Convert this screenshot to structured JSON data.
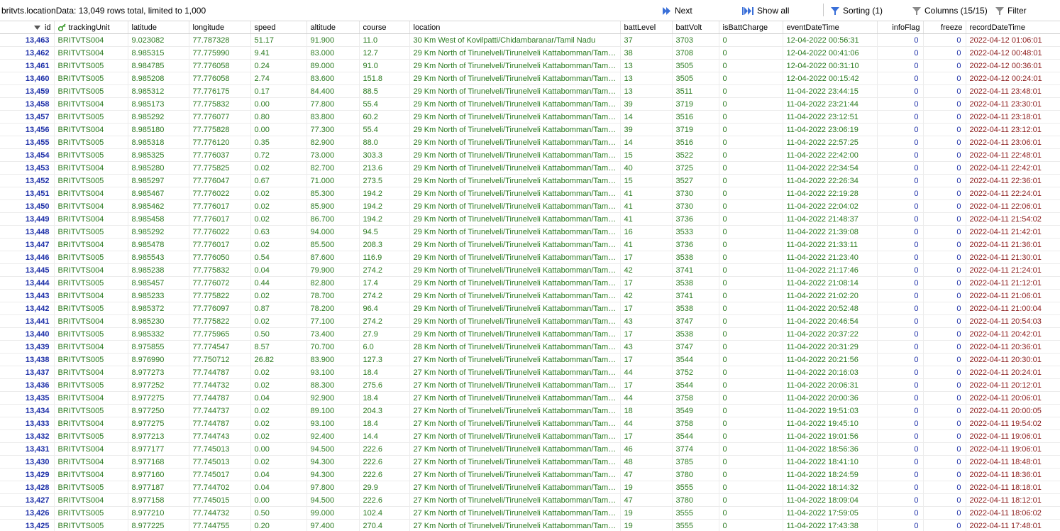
{
  "toolbar": {
    "title": "britvts.locationData: 13,049 rows total, limited to 1,000",
    "next": "Next",
    "show_all": "Show all",
    "sorting": "Sorting (1)",
    "columns": "Columns (15/15)",
    "filter": "Filter"
  },
  "columns": [
    "id",
    "trackingUnit",
    "latitude",
    "longitude",
    "speed",
    "altitude",
    "course",
    "location",
    "battLevel",
    "battVolt",
    "isBattCharge",
    "eventDateTime",
    "infoFlag",
    "freeze",
    "recordDateTime"
  ],
  "rows": [
    [
      "13,463",
      "BRITVTS004",
      "9.023082",
      "77.787328",
      "51.17",
      "91.900",
      "11.0",
      "30 Km West of Kovilpatti/Chidambaranar/Tamil Nadu",
      "37",
      "3703",
      "0",
      "12-04-2022 00:56:31",
      "0",
      "0",
      "2022-04-12 01:06:01"
    ],
    [
      "13,462",
      "BRITVTS004",
      "8.985315",
      "77.775990",
      "9.41",
      "83.000",
      "12.7",
      "29 Km North of Tirunelveli/Tirunelveli Kattabomman/Tamil...",
      "38",
      "3708",
      "0",
      "12-04-2022 00:41:06",
      "0",
      "0",
      "2022-04-12 00:48:01"
    ],
    [
      "13,461",
      "BRITVTS005",
      "8.984785",
      "77.776058",
      "0.24",
      "89.000",
      "91.0",
      "29 Km North of Tirunelveli/Tirunelveli Kattabomman/Tamil...",
      "13",
      "3505",
      "0",
      "12-04-2022 00:31:10",
      "0",
      "0",
      "2022-04-12 00:36:01"
    ],
    [
      "13,460",
      "BRITVTS005",
      "8.985208",
      "77.776058",
      "2.74",
      "83.600",
      "151.8",
      "29 Km North of Tirunelveli/Tirunelveli Kattabomman/Tamil...",
      "13",
      "3505",
      "0",
      "12-04-2022 00:15:42",
      "0",
      "0",
      "2022-04-12 00:24:01"
    ],
    [
      "13,459",
      "BRITVTS005",
      "8.985312",
      "77.776175",
      "0.17",
      "84.400",
      "88.5",
      "29 Km North of Tirunelveli/Tirunelveli Kattabomman/Tamil...",
      "13",
      "3511",
      "0",
      "11-04-2022 23:44:15",
      "0",
      "0",
      "2022-04-11 23:48:01"
    ],
    [
      "13,458",
      "BRITVTS004",
      "8.985173",
      "77.775832",
      "0.00",
      "77.800",
      "55.4",
      "29 Km North of Tirunelveli/Tirunelveli Kattabomman/Tamil...",
      "39",
      "3719",
      "0",
      "11-04-2022 23:21:44",
      "0",
      "0",
      "2022-04-11 23:30:01"
    ],
    [
      "13,457",
      "BRITVTS005",
      "8.985292",
      "77.776077",
      "0.80",
      "83.800",
      "60.2",
      "29 Km North of Tirunelveli/Tirunelveli Kattabomman/Tamil...",
      "14",
      "3516",
      "0",
      "11-04-2022 23:12:51",
      "0",
      "0",
      "2022-04-11 23:18:01"
    ],
    [
      "13,456",
      "BRITVTS004",
      "8.985180",
      "77.775828",
      "0.00",
      "77.300",
      "55.4",
      "29 Km North of Tirunelveli/Tirunelveli Kattabomman/Tamil...",
      "39",
      "3719",
      "0",
      "11-04-2022 23:06:19",
      "0",
      "0",
      "2022-04-11 23:12:01"
    ],
    [
      "13,455",
      "BRITVTS005",
      "8.985318",
      "77.776120",
      "0.35",
      "82.900",
      "88.0",
      "29 Km North of Tirunelveli/Tirunelveli Kattabomman/Tamil...",
      "14",
      "3516",
      "0",
      "11-04-2022 22:57:25",
      "0",
      "0",
      "2022-04-11 23:06:01"
    ],
    [
      "13,454",
      "BRITVTS005",
      "8.985325",
      "77.776037",
      "0.72",
      "73.000",
      "303.3",
      "29 Km North of Tirunelveli/Tirunelveli Kattabomman/Tamil...",
      "15",
      "3522",
      "0",
      "11-04-2022 22:42:00",
      "0",
      "0",
      "2022-04-11 22:48:01"
    ],
    [
      "13,453",
      "BRITVTS004",
      "8.985280",
      "77.775825",
      "0.02",
      "82.700",
      "213.6",
      "29 Km North of Tirunelveli/Tirunelveli Kattabomman/Tamil...",
      "40",
      "3725",
      "0",
      "11-04-2022 22:34:54",
      "0",
      "0",
      "2022-04-11 22:42:01"
    ],
    [
      "13,452",
      "BRITVTS005",
      "8.985297",
      "77.776047",
      "0.67",
      "71.000",
      "273.5",
      "29 Km North of Tirunelveli/Tirunelveli Kattabomman/Tamil...",
      "15",
      "3527",
      "0",
      "11-04-2022 22:26:34",
      "0",
      "0",
      "2022-04-11 22:36:01"
    ],
    [
      "13,451",
      "BRITVTS004",
      "8.985467",
      "77.776022",
      "0.02",
      "85.300",
      "194.2",
      "29 Km North of Tirunelveli/Tirunelveli Kattabomman/Tamil...",
      "41",
      "3730",
      "0",
      "11-04-2022 22:19:28",
      "0",
      "0",
      "2022-04-11 22:24:01"
    ],
    [
      "13,450",
      "BRITVTS004",
      "8.985462",
      "77.776017",
      "0.02",
      "85.900",
      "194.2",
      "29 Km North of Tirunelveli/Tirunelveli Kattabomman/Tamil...",
      "41",
      "3730",
      "0",
      "11-04-2022 22:04:02",
      "0",
      "0",
      "2022-04-11 22:06:01"
    ],
    [
      "13,449",
      "BRITVTS004",
      "8.985458",
      "77.776017",
      "0.02",
      "86.700",
      "194.2",
      "29 Km North of Tirunelveli/Tirunelveli Kattabomman/Tamil...",
      "41",
      "3736",
      "0",
      "11-04-2022 21:48:37",
      "0",
      "0",
      "2022-04-11 21:54:02"
    ],
    [
      "13,448",
      "BRITVTS005",
      "8.985292",
      "77.776022",
      "0.63",
      "94.000",
      "94.5",
      "29 Km North of Tirunelveli/Tirunelveli Kattabomman/Tamil...",
      "16",
      "3533",
      "0",
      "11-04-2022 21:39:08",
      "0",
      "0",
      "2022-04-11 21:42:01"
    ],
    [
      "13,447",
      "BRITVTS004",
      "8.985478",
      "77.776017",
      "0.02",
      "85.500",
      "208.3",
      "29 Km North of Tirunelveli/Tirunelveli Kattabomman/Tamil...",
      "41",
      "3736",
      "0",
      "11-04-2022 21:33:11",
      "0",
      "0",
      "2022-04-11 21:36:01"
    ],
    [
      "13,446",
      "BRITVTS005",
      "8.985543",
      "77.776050",
      "0.54",
      "87.600",
      "116.9",
      "29 Km North of Tirunelveli/Tirunelveli Kattabomman/Tamil...",
      "17",
      "3538",
      "0",
      "11-04-2022 21:23:40",
      "0",
      "0",
      "2022-04-11 21:30:01"
    ],
    [
      "13,445",
      "BRITVTS004",
      "8.985238",
      "77.775832",
      "0.04",
      "79.900",
      "274.2",
      "29 Km North of Tirunelveli/Tirunelveli Kattabomman/Tamil...",
      "42",
      "3741",
      "0",
      "11-04-2022 21:17:46",
      "0",
      "0",
      "2022-04-11 21:24:01"
    ],
    [
      "13,444",
      "BRITVTS005",
      "8.985457",
      "77.776072",
      "0.44",
      "82.800",
      "17.4",
      "29 Km North of Tirunelveli/Tirunelveli Kattabomman/Tamil...",
      "17",
      "3538",
      "0",
      "11-04-2022 21:08:14",
      "0",
      "0",
      "2022-04-11 21:12:01"
    ],
    [
      "13,443",
      "BRITVTS004",
      "8.985233",
      "77.775822",
      "0.02",
      "78.700",
      "274.2",
      "29 Km North of Tirunelveli/Tirunelveli Kattabomman/Tamil...",
      "42",
      "3741",
      "0",
      "11-04-2022 21:02:20",
      "0",
      "0",
      "2022-04-11 21:06:01"
    ],
    [
      "13,442",
      "BRITVTS005",
      "8.985372",
      "77.776097",
      "0.87",
      "78.200",
      "96.4",
      "29 Km North of Tirunelveli/Tirunelveli Kattabomman/Tamil...",
      "17",
      "3538",
      "0",
      "11-04-2022 20:52:48",
      "0",
      "0",
      "2022-04-11 21:00:04"
    ],
    [
      "13,441",
      "BRITVTS004",
      "8.985230",
      "77.775822",
      "0.02",
      "77.100",
      "274.2",
      "29 Km North of Tirunelveli/Tirunelveli Kattabomman/Tamil...",
      "43",
      "3747",
      "0",
      "11-04-2022 20:46:54",
      "0",
      "0",
      "2022-04-11 20:54:03"
    ],
    [
      "13,440",
      "BRITVTS005",
      "8.985332",
      "77.775965",
      "0.50",
      "73.400",
      "27.9",
      "29 Km North of Tirunelveli/Tirunelveli Kattabomman/Tamil...",
      "17",
      "3538",
      "0",
      "11-04-2022 20:37:22",
      "0",
      "0",
      "2022-04-11 20:42:01"
    ],
    [
      "13,439",
      "BRITVTS004",
      "8.975855",
      "77.774547",
      "8.57",
      "70.700",
      "6.0",
      "28 Km North of Tirunelveli/Tirunelveli Kattabomman/Tamil...",
      "43",
      "3747",
      "0",
      "11-04-2022 20:31:29",
      "0",
      "0",
      "2022-04-11 20:36:01"
    ],
    [
      "13,438",
      "BRITVTS005",
      "8.976990",
      "77.750712",
      "26.82",
      "83.900",
      "127.3",
      "27 Km North of Tirunelveli/Tirunelveli Kattabomman/Tamil...",
      "17",
      "3544",
      "0",
      "11-04-2022 20:21:56",
      "0",
      "0",
      "2022-04-11 20:30:01"
    ],
    [
      "13,437",
      "BRITVTS004",
      "8.977273",
      "77.744787",
      "0.02",
      "93.100",
      "18.4",
      "27 Km North of Tirunelveli/Tirunelveli Kattabomman/Tamil...",
      "44",
      "3752",
      "0",
      "11-04-2022 20:16:03",
      "0",
      "0",
      "2022-04-11 20:24:01"
    ],
    [
      "13,436",
      "BRITVTS005",
      "8.977252",
      "77.744732",
      "0.02",
      "88.300",
      "275.6",
      "27 Km North of Tirunelveli/Tirunelveli Kattabomman/Tamil...",
      "17",
      "3544",
      "0",
      "11-04-2022 20:06:31",
      "0",
      "0",
      "2022-04-11 20:12:01"
    ],
    [
      "13,435",
      "BRITVTS004",
      "8.977275",
      "77.744787",
      "0.04",
      "92.900",
      "18.4",
      "27 Km North of Tirunelveli/Tirunelveli Kattabomman/Tamil...",
      "44",
      "3758",
      "0",
      "11-04-2022 20:00:36",
      "0",
      "0",
      "2022-04-11 20:06:01"
    ],
    [
      "13,434",
      "BRITVTS005",
      "8.977250",
      "77.744737",
      "0.02",
      "89.100",
      "204.3",
      "27 Km North of Tirunelveli/Tirunelveli Kattabomman/Tamil...",
      "18",
      "3549",
      "0",
      "11-04-2022 19:51:03",
      "0",
      "0",
      "2022-04-11 20:00:05"
    ],
    [
      "13,433",
      "BRITVTS004",
      "8.977275",
      "77.744787",
      "0.02",
      "93.100",
      "18.4",
      "27 Km North of Tirunelveli/Tirunelveli Kattabomman/Tamil...",
      "44",
      "3758",
      "0",
      "11-04-2022 19:45:10",
      "0",
      "0",
      "2022-04-11 19:54:02"
    ],
    [
      "13,432",
      "BRITVTS005",
      "8.977213",
      "77.744743",
      "0.02",
      "92.400",
      "14.4",
      "27 Km North of Tirunelveli/Tirunelveli Kattabomman/Tamil...",
      "17",
      "3544",
      "0",
      "11-04-2022 19:01:56",
      "0",
      "0",
      "2022-04-11 19:06:01"
    ],
    [
      "13,431",
      "BRITVTS004",
      "8.977177",
      "77.745013",
      "0.00",
      "94.500",
      "222.6",
      "27 Km North of Tirunelveli/Tirunelveli Kattabomman/Tamil...",
      "46",
      "3774",
      "0",
      "11-04-2022 18:56:36",
      "0",
      "0",
      "2022-04-11 19:06:01"
    ],
    [
      "13,430",
      "BRITVTS004",
      "8.977168",
      "77.745013",
      "0.02",
      "94.300",
      "222.6",
      "27 Km North of Tirunelveli/Tirunelveli Kattabomman/Tamil...",
      "48",
      "3785",
      "0",
      "11-04-2022 18:41:10",
      "0",
      "0",
      "2022-04-11 18:48:01"
    ],
    [
      "13,429",
      "BRITVTS004",
      "8.977160",
      "77.745017",
      "0.04",
      "94.300",
      "222.6",
      "27 Km North of Tirunelveli/Tirunelveli Kattabomman/Tamil...",
      "47",
      "3780",
      "0",
      "11-04-2022 18:24:59",
      "0",
      "0",
      "2022-04-11 18:36:01"
    ],
    [
      "13,428",
      "BRITVTS005",
      "8.977187",
      "77.744702",
      "0.04",
      "97.800",
      "29.9",
      "27 Km North of Tirunelveli/Tirunelveli Kattabomman/Tamil...",
      "19",
      "3555",
      "0",
      "11-04-2022 18:14:32",
      "0",
      "0",
      "2022-04-11 18:18:01"
    ],
    [
      "13,427",
      "BRITVTS004",
      "8.977158",
      "77.745015",
      "0.00",
      "94.500",
      "222.6",
      "27 Km North of Tirunelveli/Tirunelveli Kattabomman/Tamil...",
      "47",
      "3780",
      "0",
      "11-04-2022 18:09:04",
      "0",
      "0",
      "2022-04-11 18:12:01"
    ],
    [
      "13,426",
      "BRITVTS005",
      "8.977210",
      "77.744732",
      "0.50",
      "99.000",
      "102.4",
      "27 Km North of Tirunelveli/Tirunelveli Kattabomman/Tamil...",
      "19",
      "3555",
      "0",
      "11-04-2022 17:59:05",
      "0",
      "0",
      "2022-04-11 18:06:02"
    ],
    [
      "13,425",
      "BRITVTS005",
      "8.977225",
      "77.744755",
      "0.20",
      "97.400",
      "270.4",
      "27 Km North of Tirunelveli/Tirunelveli Kattabomman/Tamil...",
      "19",
      "3555",
      "0",
      "11-04-2022 17:43:38",
      "0",
      "0",
      "2022-04-11 17:48:01"
    ]
  ],
  "colors": {
    "id": "#1c2fa8",
    "text": "#2a7a1f",
    "date": "#8b1a1a",
    "accent": "#3a6fd8"
  }
}
